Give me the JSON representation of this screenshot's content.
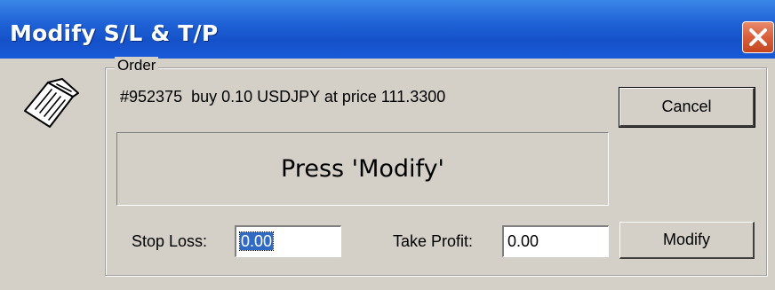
{
  "window": {
    "title": "Modify S/L & T/P"
  },
  "group": {
    "label": "Order"
  },
  "order": {
    "info": "#952375  buy 0.10 USDJPY at price 111.3300"
  },
  "status": {
    "message": "Press 'Modify'"
  },
  "buttons": {
    "cancel_label": "Cancel",
    "modify_label": "Modify"
  },
  "stop_loss": {
    "label": "Stop Loss:",
    "value": "0.00"
  },
  "take_profit": {
    "label": "Take Profit:",
    "value": "0.00"
  },
  "icons": {
    "order": "order-document-icon",
    "close": "close-icon"
  },
  "colors": {
    "titlebar": "#1f62d6",
    "close_button": "#d95f3a",
    "dialog_background": "#d4d0c8",
    "selection": "#316ac5"
  }
}
